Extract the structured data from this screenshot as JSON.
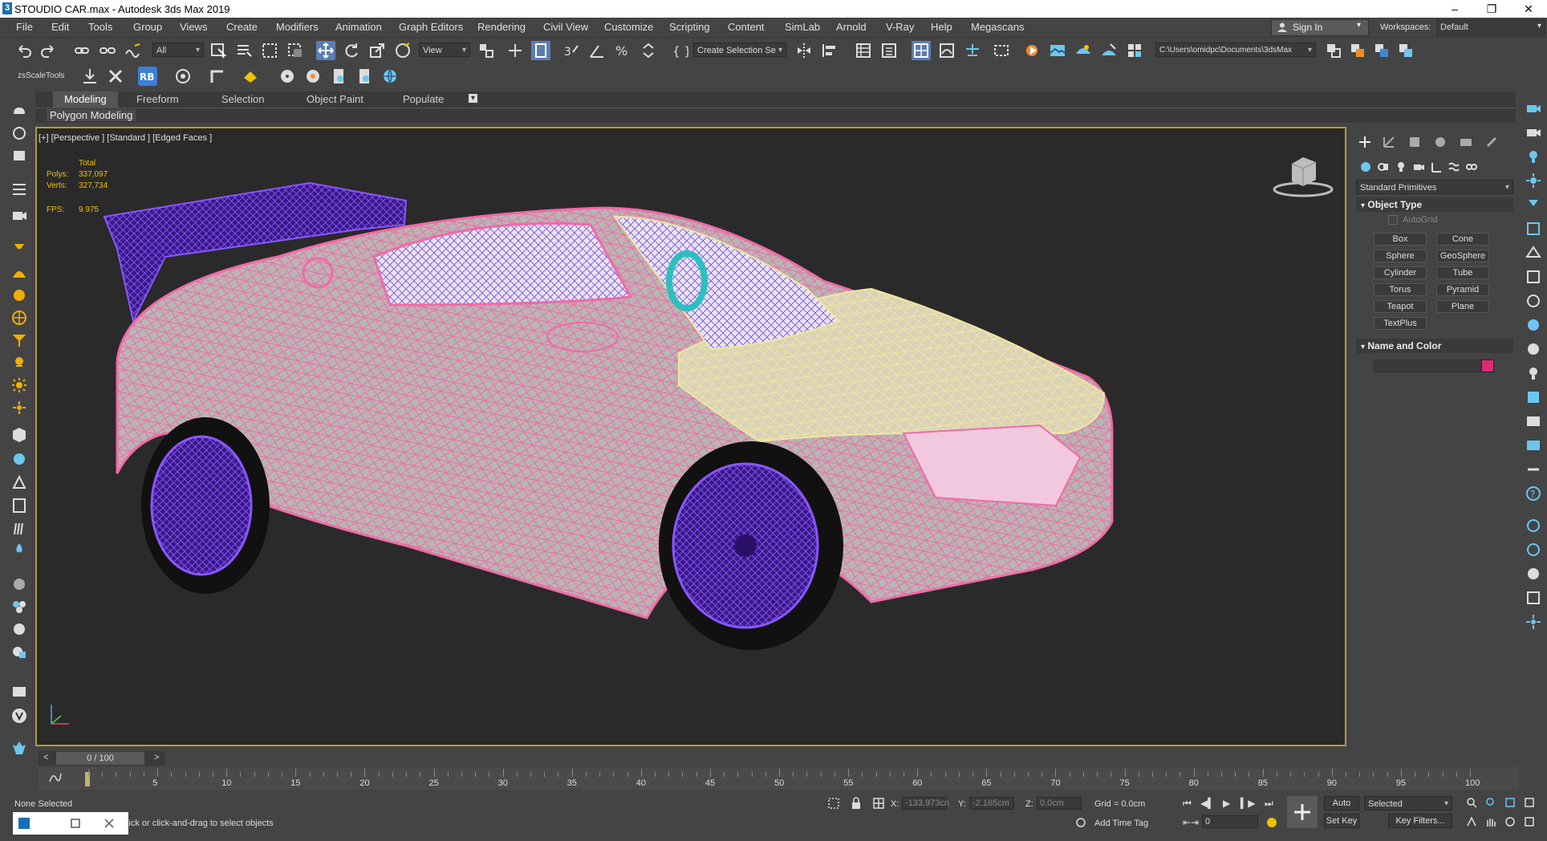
{
  "window": {
    "title": "STOUDIO  CAR.max - Autodesk 3ds Max 2019",
    "app_icon_letter": "3"
  },
  "menubar": {
    "items": [
      "File",
      "Edit",
      "Tools",
      "Group",
      "Views",
      "Create",
      "Modifiers",
      "Animation",
      "Graph Editors",
      "Rendering",
      "Civil View",
      "Customize",
      "Scripting",
      "Content",
      "SimLab",
      "Arnold",
      "V-Ray",
      "Help",
      "Megascans"
    ],
    "sign_in": "Sign In",
    "workspaces_label": "Workspaces:",
    "workspace_value": "Default"
  },
  "toolbar": {
    "selection_filter": "All",
    "reference_coord": "View",
    "named_selection": "Create Selection Se",
    "project_path": "C:\\Users\\omidpc\\Documents\\3dsMax",
    "zsscale_label": "zsScaleTools"
  },
  "ribbon": {
    "tabs": [
      "Modeling",
      "Freeform",
      "Selection",
      "Object Paint",
      "Populate"
    ],
    "active_tab": "Modeling",
    "sub_label": "Polygon Modeling"
  },
  "viewport": {
    "label": "[+] [Perspective ] [Standard ] [Edged Faces ]",
    "stats": {
      "total_label": "Total",
      "polys_label": "Polys:",
      "polys_value": "337,097",
      "verts_label": "Verts:",
      "verts_value": "327,734",
      "fps_label": "FPS:",
      "fps_value": "9.975"
    },
    "axis_labels": {
      "x": "x",
      "y": "y",
      "z": "z"
    }
  },
  "command_panel": {
    "category": "Standard Primitives",
    "object_type_title": "Object Type",
    "autogrid_label": "AutoGrid",
    "buttons": [
      "Box",
      "Cone",
      "Sphere",
      "GeoSphere",
      "Cylinder",
      "Tube",
      "Torus",
      "Pyramid",
      "Teapot",
      "Plane",
      "TextPlus"
    ],
    "name_color_title": "Name and Color",
    "swatch_color": "#e0287a"
  },
  "timeline": {
    "frame_display": "0 / 100",
    "prev": "<",
    "next": ">",
    "ticks": [
      "5",
      "10",
      "15",
      "20",
      "25",
      "30",
      "35",
      "40",
      "45",
      "50",
      "55",
      "60",
      "65",
      "70",
      "75",
      "80",
      "85",
      "90",
      "95",
      "100"
    ]
  },
  "status": {
    "selection": "None Selected",
    "prompt": "Click or click-and-drag to select objects",
    "x_label": "X:",
    "x_value": "-133.973cn",
    "y_label": "Y:",
    "y_value": "-2.165cm",
    "z_label": "Z:",
    "z_value": "0.0cm",
    "grid": "Grid = 0.0cm",
    "add_time_tag": "Add Time Tag",
    "auto_key": "Auto Key",
    "set_key": "Set Key",
    "key_mode": "Selected",
    "key_filters": "Key Filters...",
    "current_frame": "0"
  },
  "colors": {
    "body_wire": "#f06aa8",
    "hood_wire": "#f0e6b0",
    "wheel_wire": "#6a2bd6",
    "viewport_border": "#b49a3c",
    "stat_text": "#f0c000"
  }
}
